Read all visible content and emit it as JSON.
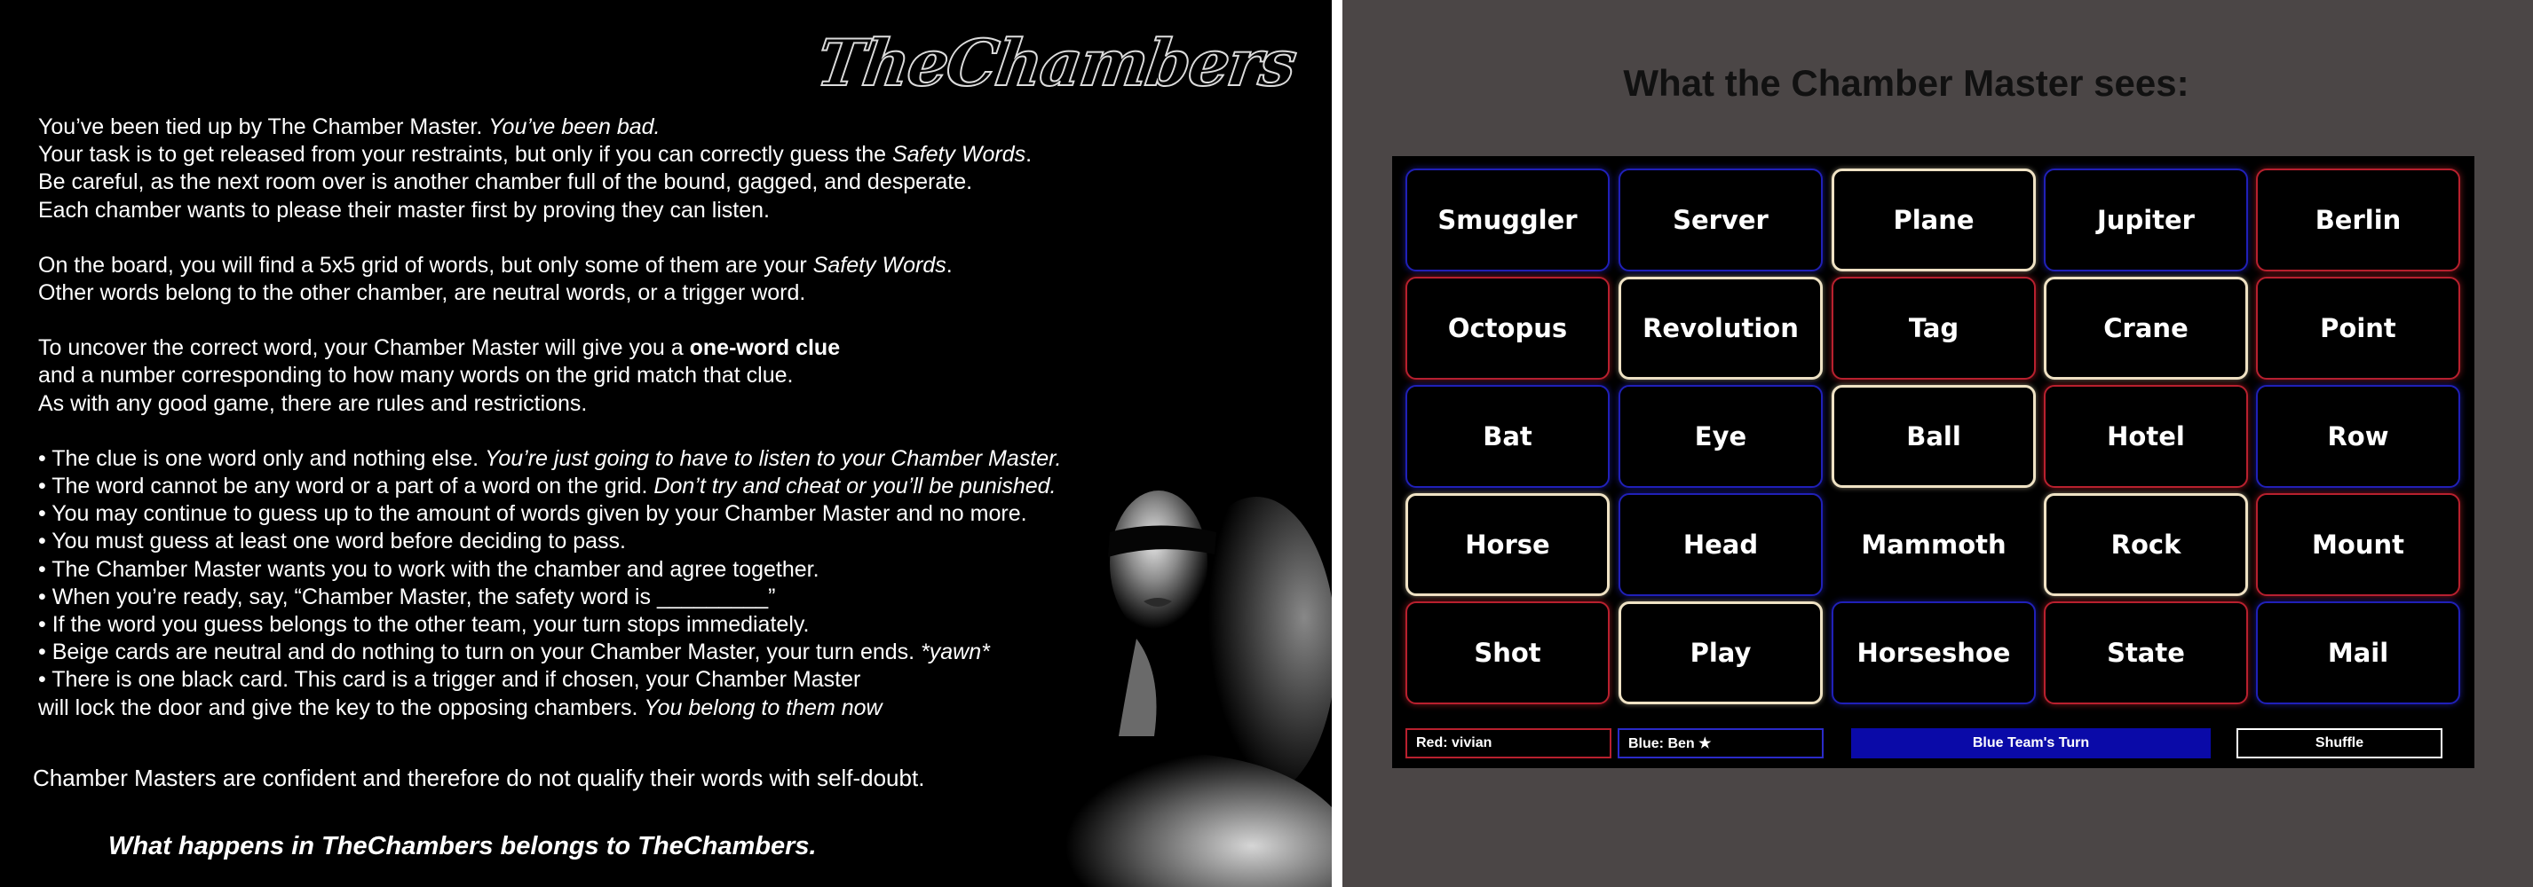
{
  "left": {
    "logo": "TheChambers",
    "intro": [
      {
        "text": "You’ve been tied up by The Chamber Master. ",
        "em": "You’ve been bad."
      },
      {
        "text": "Your task is to get released from your restraints, but only if you can correctly guess the ",
        "em": "Safety Words",
        "after": "."
      },
      {
        "text": "Be careful, as the next room over is another chamber full of the bound, gagged, and desperate."
      },
      {
        "text": "Each chamber wants to please their master first by proving they can listen."
      }
    ],
    "board_info": [
      {
        "text": "On the board, you will find a 5x5 grid of words, but only some of them are your ",
        "em": "Safety Words",
        "after": "."
      },
      {
        "text": "Other words belong to the other chamber, are neutral words, or a trigger word."
      }
    ],
    "clue_info": [
      {
        "text": "To uncover the correct word, your Chamber Master will give you a ",
        "strong": "one-word clue"
      },
      {
        "text": "and a number corresponding to how many words on the grid match that clue."
      },
      {
        "text": "As with any good game, there are rules and restrictions."
      }
    ],
    "bullets": [
      {
        "text": "• The clue is one word only and nothing else. ",
        "em": "You’re just going to have to listen to your Chamber Master."
      },
      {
        "text": "• The word cannot be any word or a part of a word on the grid. ",
        "em": "Don’t try and cheat or you’ll be punished."
      },
      {
        "text": "• You may continue to guess up to the amount of words given by your Chamber Master and no more."
      },
      {
        "text": "• You must guess at least one word before deciding to pass."
      },
      {
        "text": "• The Chamber Master wants you to work with the chamber and agree together."
      },
      {
        "text": "• When you’re ready, say, “Chamber Master, the safety word is _________”"
      },
      {
        "text": "• If the word you guess belongs to the other team, your turn stops immediately."
      },
      {
        "text": "• Beige cards are neutral and do nothing to turn on your Chamber Master, your turn ends. ",
        "em": "*yawn*"
      },
      {
        "text": "• There is one black card. This card is a trigger and if chosen, your Chamber Master"
      },
      {
        "text": "will lock the door and give the key to the opposing chambers. ",
        "em": "You belong to them now"
      }
    ],
    "confident": "Chamber Masters are confident and therefore do not qualify their words with self-doubt.",
    "closing": "What happens in TheChambers belongs to TheChambers."
  },
  "right": {
    "title": "What the Chamber Master sees:",
    "cards": [
      {
        "word": "Smuggler",
        "team": "blue"
      },
      {
        "word": "Server",
        "team": "blue"
      },
      {
        "word": "Plane",
        "team": "beige"
      },
      {
        "word": "Jupiter",
        "team": "blue"
      },
      {
        "word": "Berlin",
        "team": "red"
      },
      {
        "word": "Octopus",
        "team": "red"
      },
      {
        "word": "Revolution",
        "team": "beige"
      },
      {
        "word": "Tag",
        "team": "red"
      },
      {
        "word": "Crane",
        "team": "beige"
      },
      {
        "word": "Point",
        "team": "red"
      },
      {
        "word": "Bat",
        "team": "blue"
      },
      {
        "word": "Eye",
        "team": "blue"
      },
      {
        "word": "Ball",
        "team": "beige"
      },
      {
        "word": "Hotel",
        "team": "red"
      },
      {
        "word": "Row",
        "team": "blue"
      },
      {
        "word": "Horse",
        "team": "beige"
      },
      {
        "word": "Head",
        "team": "blue"
      },
      {
        "word": "Mammoth",
        "team": "black"
      },
      {
        "word": "Rock",
        "team": "beige"
      },
      {
        "word": "Mount",
        "team": "red"
      },
      {
        "word": "Shot",
        "team": "red"
      },
      {
        "word": "Play",
        "team": "beige"
      },
      {
        "word": "Horseshoe",
        "team": "blue"
      },
      {
        "word": "State",
        "team": "red"
      },
      {
        "word": "Mail",
        "team": "blue"
      }
    ],
    "red_team": "Red: vivian",
    "blue_team": "Blue: Ben ★",
    "turn": "Blue Team's Turn",
    "shuffle": "Shuffle"
  },
  "colors": {
    "blue_team": "#2020b8",
    "red_team": "#b8202e",
    "neutral": "#efe2c4",
    "turn_banner": "#0a0aa8",
    "right_bg": "#4b4646"
  }
}
